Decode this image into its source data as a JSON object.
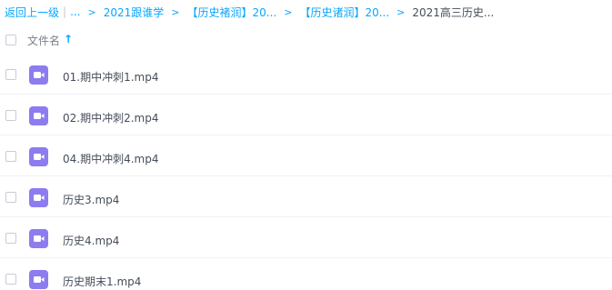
{
  "breadcrumb": {
    "back_label": "返回上一级",
    "ellipsis": "...",
    "items": [
      "2021跟谁学",
      "【历史褚润】20...",
      "【历史诸润】20..."
    ],
    "current": "2021高三历史..."
  },
  "header": {
    "filename_label": "文件名",
    "sort_arrow": "↑"
  },
  "files": [
    {
      "name": "01.期中冲刺1.mp4",
      "icon": "video-file-icon"
    },
    {
      "name": "02.期中冲刺2.mp4",
      "icon": "video-file-icon"
    },
    {
      "name": "04.期中冲刺4.mp4",
      "icon": "video-file-icon"
    },
    {
      "name": "历史3.mp4",
      "icon": "video-file-icon"
    },
    {
      "name": "历史4.mp4",
      "icon": "video-file-icon"
    },
    {
      "name": "历史期末1.mp4",
      "icon": "video-file-icon"
    }
  ],
  "colors": {
    "accent": "#06a7ff",
    "video_icon": "#8c7cf0",
    "text": "#454d5a"
  }
}
